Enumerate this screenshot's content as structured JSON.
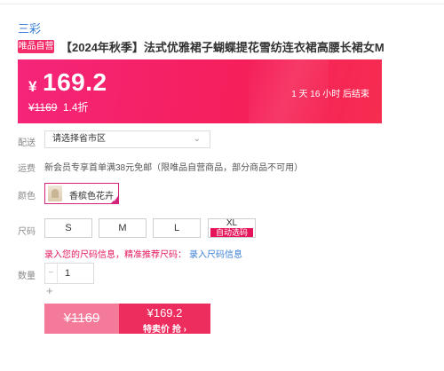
{
  "brand": "三彩",
  "product": {
    "badge": "唯品自营",
    "title": "【2024年秋季】法式优雅裙子蝴蝶提花雪纺连衣裙高腰长裙女M"
  },
  "price": {
    "currency": "¥",
    "current": "169.2",
    "original": "¥1169",
    "discount": "1.4折",
    "countdown": "1 天 16 小时 后结束"
  },
  "delivery": {
    "label": "配送",
    "placeholder": "请选择省市区"
  },
  "freight": {
    "label": "运费",
    "text": "新会员专享首单满38元免邮（限唯品自营商品，部分商品不可用）"
  },
  "color": {
    "label": "颜色",
    "selected": "香槟色花卉"
  },
  "size": {
    "label": "尺码",
    "options": [
      "S",
      "M",
      "L",
      "XL"
    ],
    "auto_tag": "自动选码",
    "hint": "录入您的尺码信息，精准推荐尺码：",
    "hint_link": "录入尺码信息"
  },
  "quantity": {
    "label": "数量",
    "value": "1",
    "minus": "−",
    "plus": "+"
  },
  "buy": {
    "original_price": "¥1169",
    "sale_price": "¥169.2",
    "sale_label": "特卖价 抢 ›"
  },
  "colors": {
    "accent": "#f22d69",
    "link": "#3a7fd5"
  }
}
